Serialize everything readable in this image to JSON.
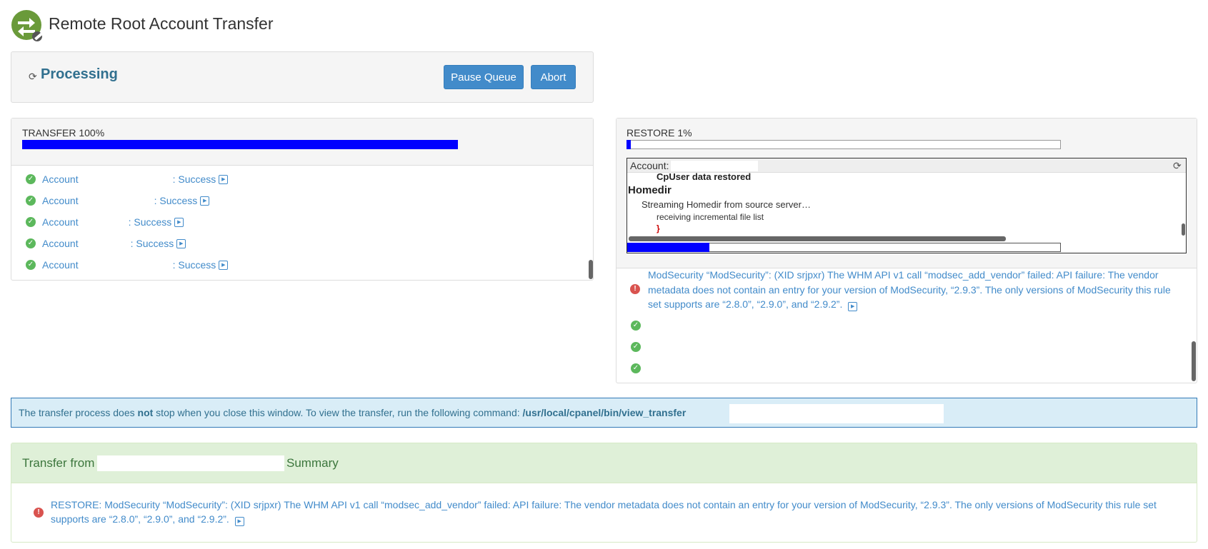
{
  "header": {
    "title": "Remote Root Account Transfer",
    "logo_icon": "transfer-wrench-icon"
  },
  "processing": {
    "status": "Processing",
    "pause_label": "Pause Queue",
    "abort_label": "Abort"
  },
  "transfer": {
    "label": "TRANSFER 100%",
    "progress_percent": 100,
    "rows": [
      {
        "label": "Account",
        "status": ": Success"
      },
      {
        "label": "Account",
        "status": ": Success"
      },
      {
        "label": "Account",
        "status": ": Success"
      },
      {
        "label": "Account",
        "status": ": Success"
      },
      {
        "label": "Account",
        "status": ": Success"
      }
    ]
  },
  "restore": {
    "label": "RESTORE 1%",
    "progress_percent": 1,
    "console": {
      "account_label": "Account:",
      "lines": [
        "CpUser data restored",
        "Homedir",
        "Streaming Homedir from source server…",
        "receiving incremental file list",
        "}"
      ],
      "progress_percent": 19
    },
    "error": "ModSecurity “ModSecurity”: (XID srjpxr) The WHM API v1 call “modsec_add_vendor” failed: API failure: The vendor metadata does not contain an entry for your version of ModSecurity, “2.9.3”. The only versions of ModSecurity this rule set supports are “2.8.0”, “2.9.0”, and “2.9.2”.",
    "success_rows": 3
  },
  "info": {
    "text_before": "The transfer process does ",
    "text_bold": "not",
    "text_after": " stop when you close this window. To view the transfer, run the following command: ",
    "command": "/usr/local/cpanel/bin/view_transfer"
  },
  "summary": {
    "prefix": "Transfer from",
    "suffix": "Summary",
    "error": "RESTORE: ModSecurity “ModSecurity”: (XID srjpxr) The WHM API v1 call “modsec_add_vendor” failed: API failure: The vendor metadata does not contain an entry for your version of ModSecurity, “2.9.3”. The only versions of ModSecurity this rule set supports are “2.8.0”, “2.9.0”, and “2.9.2”."
  },
  "colors": {
    "accent": "#428bca",
    "progress": "#0000ff",
    "success": "#5cb85c",
    "error": "#d9534f"
  }
}
